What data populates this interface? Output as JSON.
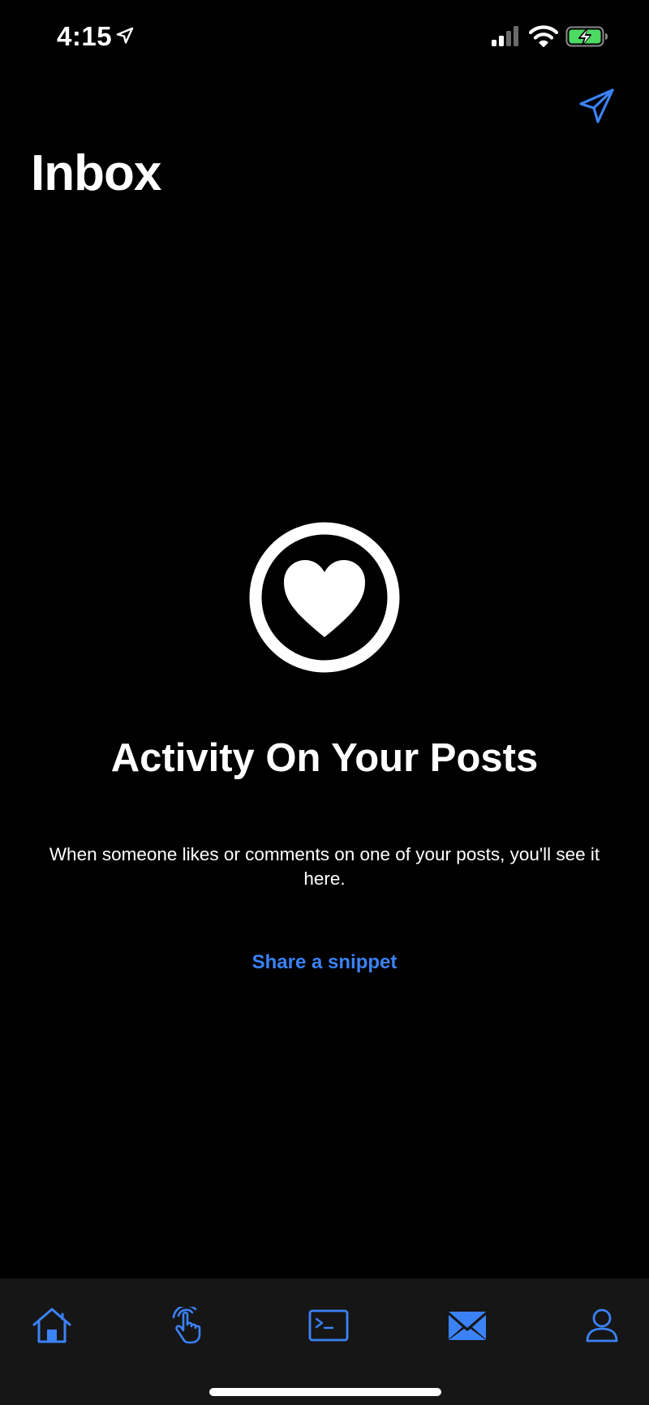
{
  "status_bar": {
    "time": "4:15",
    "icons": [
      "location-arrow-icon",
      "cellular-signal-icon",
      "wifi-icon",
      "battery-charging-icon"
    ]
  },
  "header": {
    "title": "Inbox",
    "compose_icon": "paper-plane-icon"
  },
  "empty_state": {
    "icon": "heart-circle-icon",
    "title": "Activity On Your Posts",
    "description": "When someone likes or comments on one of your posts, you'll see it here.",
    "action_label": "Share a snippet"
  },
  "tab_bar": {
    "tabs": [
      {
        "id": "home",
        "icon": "home-icon"
      },
      {
        "id": "snaps",
        "icon": "hand-tap-icon"
      },
      {
        "id": "terminal",
        "icon": "terminal-icon"
      },
      {
        "id": "inbox",
        "icon": "envelope-icon",
        "active": true
      },
      {
        "id": "profile",
        "icon": "person-icon"
      }
    ]
  },
  "colors": {
    "background": "#000000",
    "accent": "#3b82f6",
    "tab_bar_background": "#161616",
    "battery_green": "#4cd964"
  }
}
